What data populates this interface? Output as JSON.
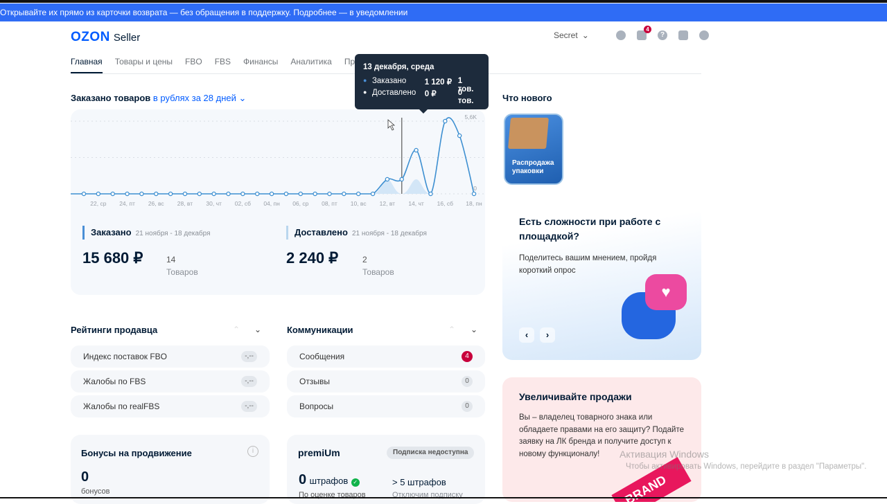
{
  "banner": "Открывайте их прямо из карточки возврата — без обращения в поддержку. Подробнее — в уведомлении",
  "header": {
    "logo": "OZON",
    "logo_suffix": "Seller",
    "account": "Secret",
    "notif_count": "4"
  },
  "nav": [
    "Главная",
    "Товары и цены",
    "FBO",
    "FBS",
    "Финансы",
    "Аналитика",
    "Продвижение"
  ],
  "chart_section": {
    "title": "Заказано товаров",
    "filter": "в рублях за 28 дней"
  },
  "tooltip": {
    "date": "13 декабря, среда",
    "rows": [
      {
        "name": "Заказано",
        "value": "1 120 ₽",
        "count": "1 тов."
      },
      {
        "name": "Доставлено",
        "value": "0 ₽",
        "count": "0 тов."
      }
    ]
  },
  "chart_data": {
    "type": "line",
    "x": [
      "21.11",
      "22.11",
      "23.11",
      "24.11",
      "25.11",
      "26.11",
      "27.11",
      "28.11",
      "29.11",
      "30.11",
      "01.12",
      "02.12",
      "03.12",
      "04.12",
      "05.12",
      "06.12",
      "07.12",
      "08.12",
      "09.12",
      "10.12",
      "11.12",
      "12.12",
      "13.12",
      "14.12",
      "15.12",
      "16.12",
      "17.12",
      "18.12"
    ],
    "tick_labels": [
      "22, ср",
      "24, пт",
      "26, вс",
      "28, вт",
      "30, чт",
      "02, сб",
      "04, пн",
      "06, ср",
      "08, пт",
      "10, вс",
      "12, вт",
      "14, чт",
      "16, сб",
      "18, пн"
    ],
    "y_tick_labels": [
      "5,6K",
      "0"
    ],
    "ylim": [
      0,
      5600
    ],
    "grid": true,
    "series": [
      {
        "name": "Заказано",
        "type": "line",
        "color": "#3d8fd1",
        "values": [
          0,
          0,
          0,
          0,
          0,
          0,
          0,
          0,
          0,
          0,
          0,
          0,
          0,
          0,
          0,
          0,
          0,
          0,
          0,
          0,
          0,
          1120,
          1120,
          3360,
          0,
          5600,
          4480,
          0
        ]
      },
      {
        "name": "Доставлено",
        "type": "area",
        "color": "#d3e6f7",
        "values": [
          0,
          0,
          0,
          0,
          0,
          0,
          0,
          0,
          0,
          0,
          0,
          0,
          0,
          0,
          0,
          0,
          0,
          0,
          0,
          0,
          0,
          1120,
          0,
          1120,
          0,
          0,
          0,
          0
        ]
      }
    ],
    "hover_index": 22
  },
  "summary": [
    {
      "label": "Заказано",
      "period": "21 ноября - 18 декабря",
      "amount": "15 680 ₽",
      "count": "14",
      "count_label": "Товаров"
    },
    {
      "label": "Доставлено",
      "period": "21 ноября - 18 декабря",
      "amount": "2 240 ₽",
      "count": "2",
      "count_label": "Товаров"
    }
  ],
  "ratings": {
    "title": "Рейтинги продавца",
    "items": [
      {
        "label": "Индекс поставок FBO",
        "value": "-,--"
      },
      {
        "label": "Жалобы по FBS",
        "value": "-,--"
      },
      {
        "label": "Жалобы по realFBS",
        "value": "-,--"
      }
    ]
  },
  "comms": {
    "title": "Коммуникации",
    "items": [
      {
        "label": "Сообщения",
        "value": "4"
      },
      {
        "label": "Отзывы",
        "value": "0"
      },
      {
        "label": "Вопросы",
        "value": "0"
      }
    ]
  },
  "bonus": {
    "title": "Бонусы на продвижение",
    "value": "0",
    "unit": "бонусов"
  },
  "premium": {
    "logo": "premiUm",
    "status": "Подписка недоступна",
    "fines": "0",
    "fines_label": "штрафов",
    "fines_sub": "По оценке товаров",
    "limit": "> 5 штрафов",
    "limit_sub": "Отключим подписку"
  },
  "whats_new": {
    "title": "Что нового",
    "tile": "Распродажа упаковки"
  },
  "survey": {
    "title": "Есть сложности при работе с площадкой?",
    "text": "Поделитесь вашим мнением, пройдя короткий опрос"
  },
  "sales": {
    "title": "Увеличивайте продажи",
    "text": "Вы – владелец товарного знака или обладаете правами на его защиту? Подайте заявку на ЛК бренда и получите доступ к новому функционалу!",
    "tag": "BRAND"
  },
  "watermark": {
    "title": "Активация Windows",
    "text": "Чтобы активировать Windows, перейдите в раздел \"Параметры\"."
  }
}
